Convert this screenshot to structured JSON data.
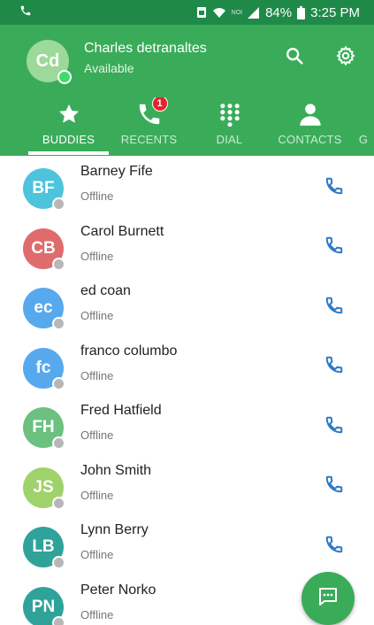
{
  "status_bar": {
    "time": "3:25 PM",
    "battery": "84%",
    "network": "NOI",
    "notification_icon": "phone-call-icon"
  },
  "profile": {
    "initials": "Cd",
    "name": "Charles detranaltes",
    "status": "Available"
  },
  "actions": {
    "search_icon": "search-icon",
    "settings_icon": "gear-icon"
  },
  "tabs": [
    {
      "label": "BUDDIES",
      "icon": "star-icon",
      "active": true
    },
    {
      "label": "RECENTS",
      "icon": "phone-icon",
      "badge": "1"
    },
    {
      "label": "DIAL",
      "icon": "dialpad-icon"
    },
    {
      "label": "CONTACTS",
      "icon": "person-icon"
    },
    {
      "label": "G",
      "icon": ""
    }
  ],
  "buddies": [
    {
      "initials": "BF",
      "name": "Barney Fife",
      "status": "Offline",
      "color": "#4dc3dc"
    },
    {
      "initials": "CB",
      "name": "Carol Burnett",
      "status": "Offline",
      "color": "#e06b6d"
    },
    {
      "initials": "ec",
      "name": "ed coan",
      "status": "Offline",
      "color": "#57a9ee"
    },
    {
      "initials": "fc",
      "name": "franco columbo",
      "status": "Offline",
      "color": "#57a9ee"
    },
    {
      "initials": "FH",
      "name": "Fred Hatfield",
      "status": "Offline",
      "color": "#6cc080"
    },
    {
      "initials": "JS",
      "name": "John Smith",
      "status": "Offline",
      "color": "#9fd26a"
    },
    {
      "initials": "LB",
      "name": "Lynn Berry",
      "status": "Offline",
      "color": "#2fa39a"
    },
    {
      "initials": "PN",
      "name": "Peter Norko",
      "status": "Offline",
      "color": "#2fa39a"
    }
  ],
  "colors": {
    "primary": "#3aac59",
    "status_bar": "#1f8a48",
    "call_icon": "#2e7bc6",
    "presence_offline": "#b7b7b7",
    "presence_available": "#3ddc6a"
  },
  "fab": {
    "icon": "chat-icon"
  }
}
